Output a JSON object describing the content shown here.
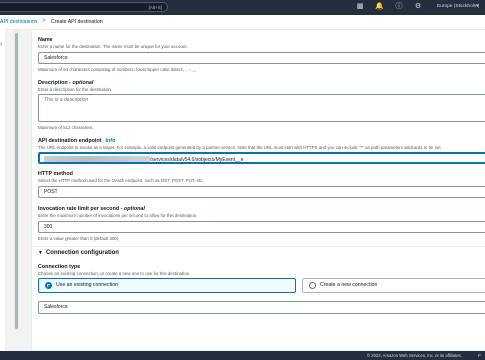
{
  "topnav": {
    "search_shortcut": "[Alt+S]",
    "region": "Europe (Stockholm)",
    "icons": [
      "cloudshell-icon",
      "notifications-icon",
      "help-icon",
      "settings-icon"
    ]
  },
  "breadcrumb": {
    "parent": "API destinations",
    "separator": ">",
    "current": "Create API destination"
  },
  "form": {
    "name": {
      "label": "Name",
      "desc": "Enter a name for the destination. The name must be unique for your account.",
      "value": "Salesforce",
      "hint": "Maximum of 64 characters consisting of numbers, lower/upper case letters, ., -, _."
    },
    "description": {
      "label": "Description - ",
      "label_optional": "optional",
      "desc": "Enter a description for the destination.",
      "placeholder": "This is a description",
      "hint": "Maximum of 512 characters."
    },
    "endpoint": {
      "label": "API destination endpoint",
      "info": "Info",
      "desc": "The URL endpoint to invoke as a target. For example, a valid endpoint generated by a partner service. Note that the URL must start with HTTPS and you can include \"*\" as path parameters wildcards to be set",
      "value_suffix": "/services/data/v54.0/sobjects/MyEvent__e"
    },
    "http_method": {
      "label": "HTTP method",
      "desc": "Select the HTTP method used for the OAuth endpoint, such as GET, POST, PUT, etc.",
      "value": "POST"
    },
    "rate_limit": {
      "label": "Invocation rate limit per second - ",
      "label_optional": "optional",
      "desc": "Enter the maximum number of invocations per second to allow for this destination.",
      "value": "300",
      "hint": "Enter a value greater than 0 (default 300)."
    }
  },
  "connection": {
    "section_title": "Connection configuration",
    "type_label": "Connection type",
    "type_desc": "Choose an existing connection, or create a new one to use for this destination.",
    "option_existing": "Use an existing connection",
    "option_new": "Create a new connection",
    "selected": "existing",
    "selected_connection": "Salesforce"
  },
  "footer": {
    "copyright": "© 2023, Amazon Web Services, Inc. or its affiliates.",
    "trailing": "P"
  }
}
